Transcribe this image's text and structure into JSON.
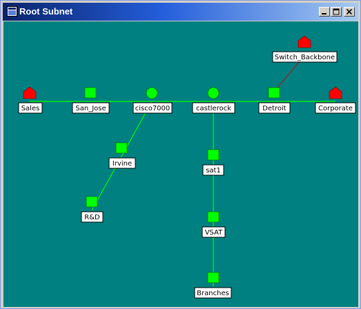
{
  "window": {
    "title": "Root Subnet",
    "minimize_icon": "minimize-icon",
    "maximize_icon": "maximize-icon",
    "close_icon": "close-icon"
  },
  "colors": {
    "canvas_bg": "#008080",
    "link": "#00ff00",
    "link_down": "#a02020",
    "node_up": "#00ff00",
    "node_down": "#ff0000"
  },
  "nodes": [
    {
      "id": "sales",
      "label": "Sales",
      "shape": "house",
      "status": "down"
    },
    {
      "id": "san_jose",
      "label": "San_Jose",
      "shape": "square",
      "status": "up"
    },
    {
      "id": "cisco7000",
      "label": "cisco7000",
      "shape": "circle",
      "status": "up"
    },
    {
      "id": "castlerock",
      "label": "castlerock",
      "shape": "circle",
      "status": "up"
    },
    {
      "id": "detroit",
      "label": "Detroit",
      "shape": "square",
      "status": "up"
    },
    {
      "id": "corporate",
      "label": "Corporate",
      "shape": "house",
      "status": "down"
    },
    {
      "id": "switch_backbone",
      "label": "Switch_Backbone",
      "shape": "house",
      "status": "down"
    },
    {
      "id": "irvine",
      "label": "Irvine",
      "shape": "square",
      "status": "up"
    },
    {
      "id": "rd",
      "label": "R&D",
      "shape": "square",
      "status": "up"
    },
    {
      "id": "sat1",
      "label": "sat1",
      "shape": "square",
      "status": "up"
    },
    {
      "id": "vsat",
      "label": "VSAT",
      "shape": "square",
      "status": "up"
    },
    {
      "id": "branches",
      "label": "Branches",
      "shape": "square",
      "status": "up"
    }
  ],
  "links": [
    {
      "from": "sales",
      "to": "san_jose",
      "status": "up"
    },
    {
      "from": "san_jose",
      "to": "cisco7000",
      "status": "up"
    },
    {
      "from": "cisco7000",
      "to": "castlerock",
      "status": "up"
    },
    {
      "from": "castlerock",
      "to": "detroit",
      "status": "up"
    },
    {
      "from": "detroit",
      "to": "corporate",
      "status": "up"
    },
    {
      "from": "detroit",
      "to": "switch_backbone",
      "status": "down"
    },
    {
      "from": "cisco7000",
      "to": "irvine",
      "status": "up"
    },
    {
      "from": "irvine",
      "to": "rd",
      "status": "up"
    },
    {
      "from": "castlerock",
      "to": "sat1",
      "status": "up"
    },
    {
      "from": "sat1",
      "to": "vsat",
      "status": "up"
    },
    {
      "from": "vsat",
      "to": "branches",
      "status": "up"
    }
  ]
}
